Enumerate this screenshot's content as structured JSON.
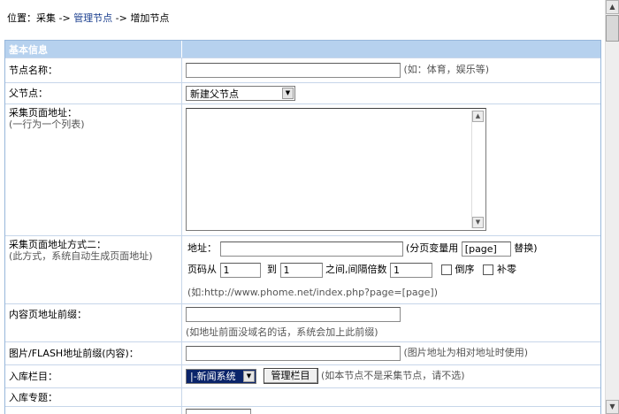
{
  "breadcrumb": {
    "prefix": "位置：采集 -> ",
    "link": "管理节点",
    "suffix": " -> 增加节点"
  },
  "section_title": "基本信息",
  "fields": {
    "node_name": {
      "label": "节点名称：",
      "value": "",
      "hint": "(如：体育，娱乐等)"
    },
    "parent_node": {
      "label": "父节点：",
      "selected": "新建父节点"
    },
    "collect_url": {
      "label": "采集页面地址：",
      "sub": "(一行为一个列表)",
      "value": ""
    },
    "collect_url_mode2": {
      "label": "采集页面地址方式二：",
      "sub": "(此方式，系统自动生成页面地址)",
      "address_label": "地址：",
      "address_value": "",
      "page_var_hint_pre": "(分页变量用",
      "page_var": "[page]",
      "page_var_hint_post": "替换)",
      "from_label": "页码从",
      "from_value": "1",
      "to_label": "到",
      "to_value": "1",
      "step_label": "之间,间隔倍数",
      "step_value": "1",
      "reverse_label": "倒序",
      "zero_pad_label": "补零",
      "example": "(如:http://www.phome.net/index.php?page=[page])"
    },
    "content_prefix": {
      "label": "内容页地址前缀：",
      "value": "",
      "hint": "(如地址前面没域名的话，系统会加上此前缀)"
    },
    "image_prefix": {
      "label": "图片/FLASH地址前缀(内容)：",
      "value": "",
      "hint": "(图片地址为相对地址时使用)"
    },
    "category": {
      "label": "入库栏目：",
      "selected": "|-新闻系统",
      "button": "管理栏目",
      "hint": "(如本节点不是采集节点，请不选)"
    },
    "topic": {
      "label": "入库专题："
    }
  },
  "icons": {
    "dropdown": "chevron-down-icon",
    "scroll_up": "arrow-up-icon",
    "scroll_down": "arrow-down-icon"
  }
}
